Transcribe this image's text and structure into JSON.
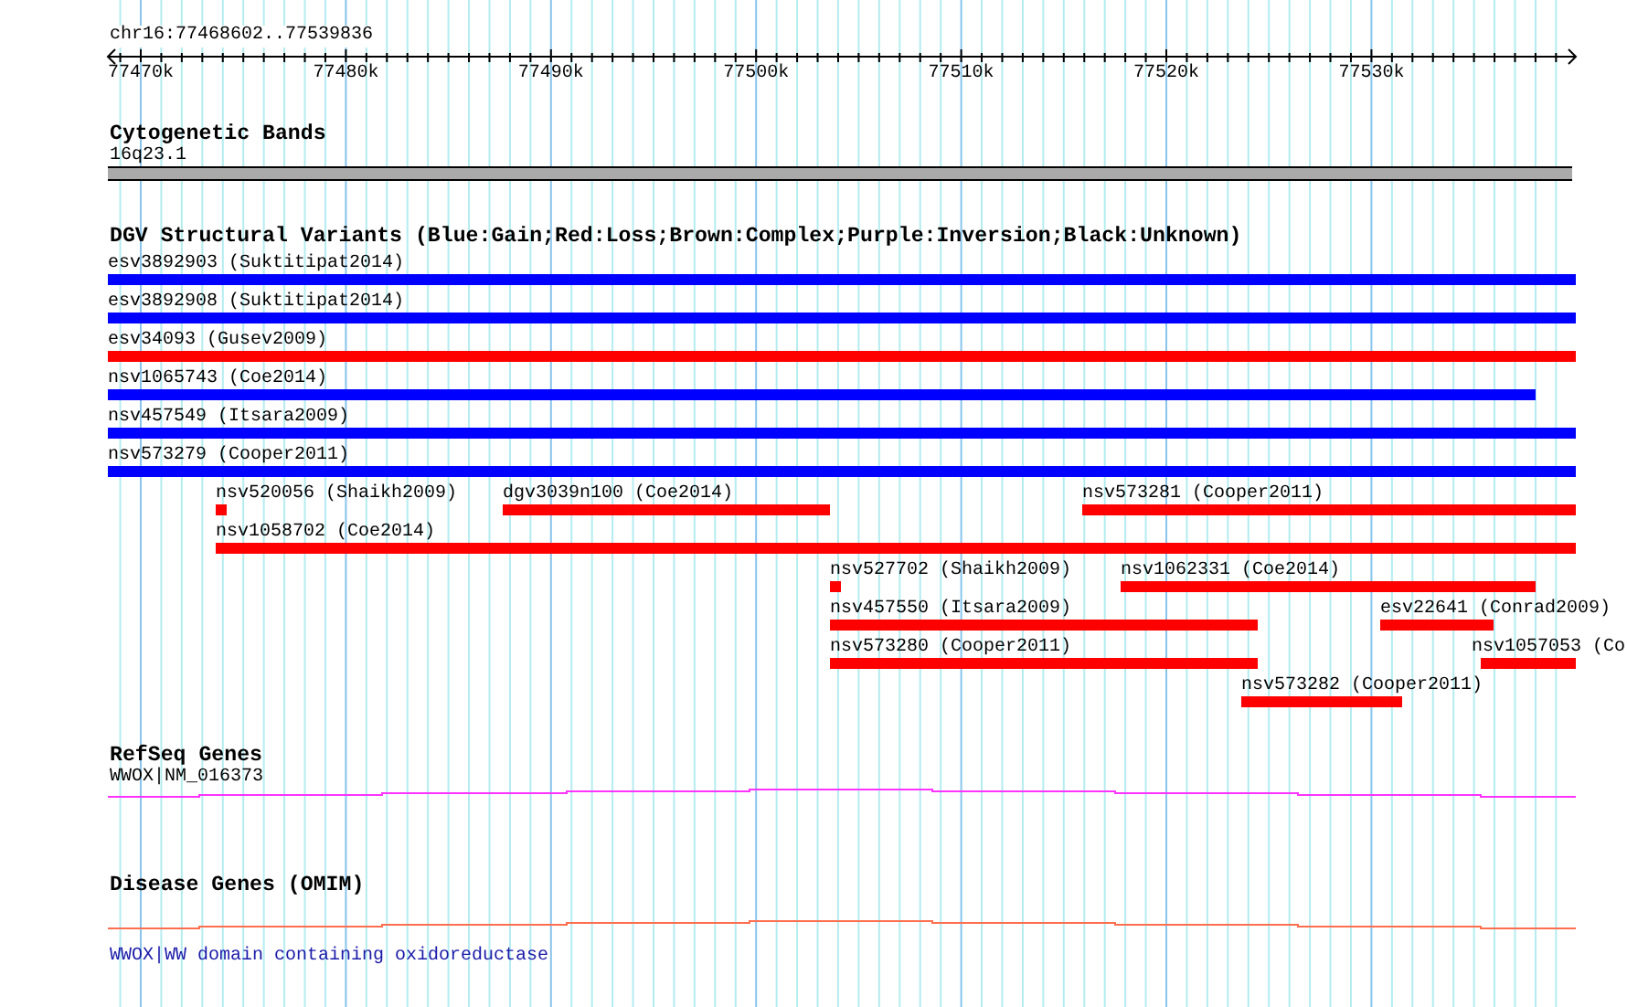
{
  "ruler": {
    "region": "chr16:77468602..77539836",
    "ticks": [
      "77470k",
      "77480k",
      "77490k",
      "77500k",
      "77510k",
      "77520k",
      "77530k"
    ]
  },
  "tracks": [
    {
      "kind": "cytoband",
      "title": "Cytogenetic Bands",
      "band": "16q23.1"
    },
    {
      "kind": "variants",
      "title": "DGV Structural Variants (Blue:Gain;Red:Loss;Brown:Complex;Purple:Inversion;Black:Unknown)",
      "features": [
        {
          "label": "esv3892903 (Suktitipat2014)",
          "color": "#0000ff"
        },
        {
          "label": "esv3892908 (Suktitipat2014)",
          "color": "#0000ff"
        },
        {
          "label": "esv34093 (Gusev2009)",
          "color": "#ff0000"
        },
        {
          "label": "nsv1065743 (Coe2014)",
          "color": "#0000ff"
        },
        {
          "label": "nsv457549 (Itsara2009)",
          "color": "#0000ff"
        },
        {
          "label": "nsv573279 (Cooper2011)",
          "color": "#0000ff"
        },
        {
          "label": "nsv520056 (Shaikh2009)",
          "color": "#ff0000"
        },
        {
          "label": "dgv3039n100 (Coe2014)",
          "color": "#ff0000"
        },
        {
          "label": "nsv573281 (Cooper2011)",
          "color": "#ff0000"
        },
        {
          "label": "nsv1058702 (Coe2014)",
          "color": "#ff0000"
        },
        {
          "label": "nsv527702 (Shaikh2009)",
          "color": "#ff0000"
        },
        {
          "label": "nsv1062331 (Coe2014)",
          "color": "#ff0000"
        },
        {
          "label": "nsv457550 (Itsara2009)",
          "color": "#ff0000"
        },
        {
          "label": "esv22641 (Conrad2009)",
          "color": "#ff0000"
        },
        {
          "label": "nsv573280 (Cooper2011)",
          "color": "#ff0000"
        },
        {
          "label": "nsv1057053 (Co",
          "color": "#ff0000"
        },
        {
          "label": "nsv573282 (Cooper2011)",
          "color": "#ff0000"
        }
      ]
    },
    {
      "kind": "gene",
      "title": "RefSeq Genes",
      "gene": "WWOX|NM_016373"
    },
    {
      "kind": "disease",
      "title": "Disease Genes (OMIM)",
      "gene": "WWOX|WW domain containing oxidoreductase"
    }
  ]
}
